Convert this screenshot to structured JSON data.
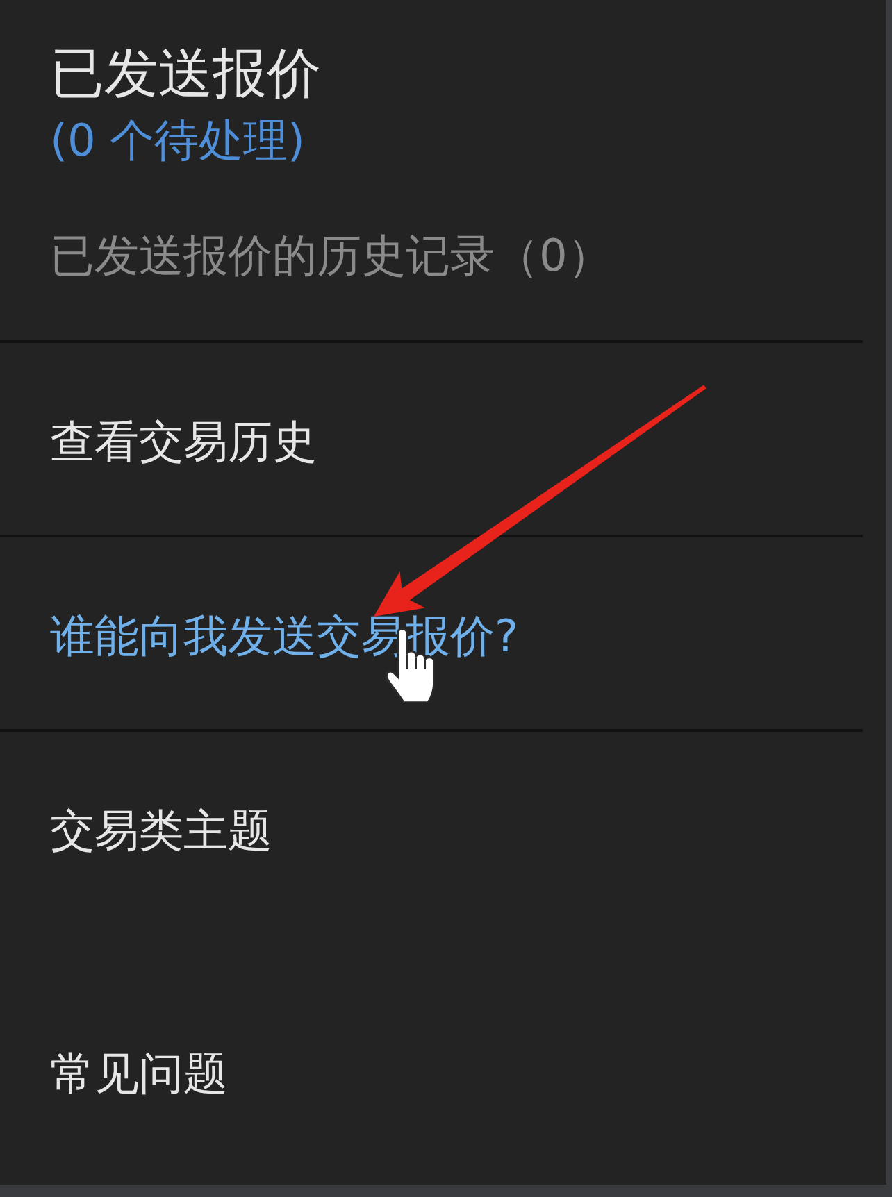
{
  "sent_offers": {
    "title": "已发送报价",
    "pending": "(0 个待处理)",
    "history": "已发送报价的历史记录（0）"
  },
  "link_groups": [
    {
      "links": [
        {
          "label": "查看交易历史",
          "hovered": false
        }
      ]
    },
    {
      "links": [
        {
          "label": "谁能向我发送交易报价?",
          "hovered": true
        }
      ]
    },
    {
      "links": [
        {
          "label": "交易类主题",
          "hovered": false
        },
        {
          "label": "常见问题",
          "hovered": false
        }
      ]
    }
  ]
}
